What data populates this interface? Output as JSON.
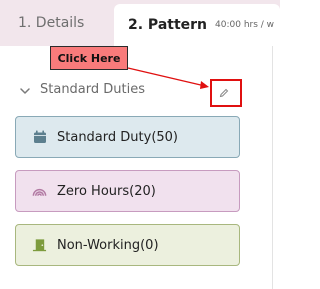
{
  "tabs": {
    "details_label": "1. Details",
    "pattern_label": "2. Pattern",
    "pattern_hours": "40:00 hrs / w"
  },
  "section": {
    "title": "Standard Duties"
  },
  "callout": {
    "text": "Click Here"
  },
  "duty_cards": [
    {
      "label": "Standard Duty(50)",
      "icon": "calendar-icon",
      "color": "#5c7f8e"
    },
    {
      "label": "Zero Hours(20)",
      "icon": "rainbow-icon",
      "color": "#b27aa3"
    },
    {
      "label": "Non-Working(0)",
      "icon": "door-exit-icon",
      "color": "#7d9b3d"
    }
  ],
  "colors": {
    "tabbar_bg": "#f2e6ec",
    "callout_bg": "#f97b7b",
    "highlight": "#e01010"
  }
}
